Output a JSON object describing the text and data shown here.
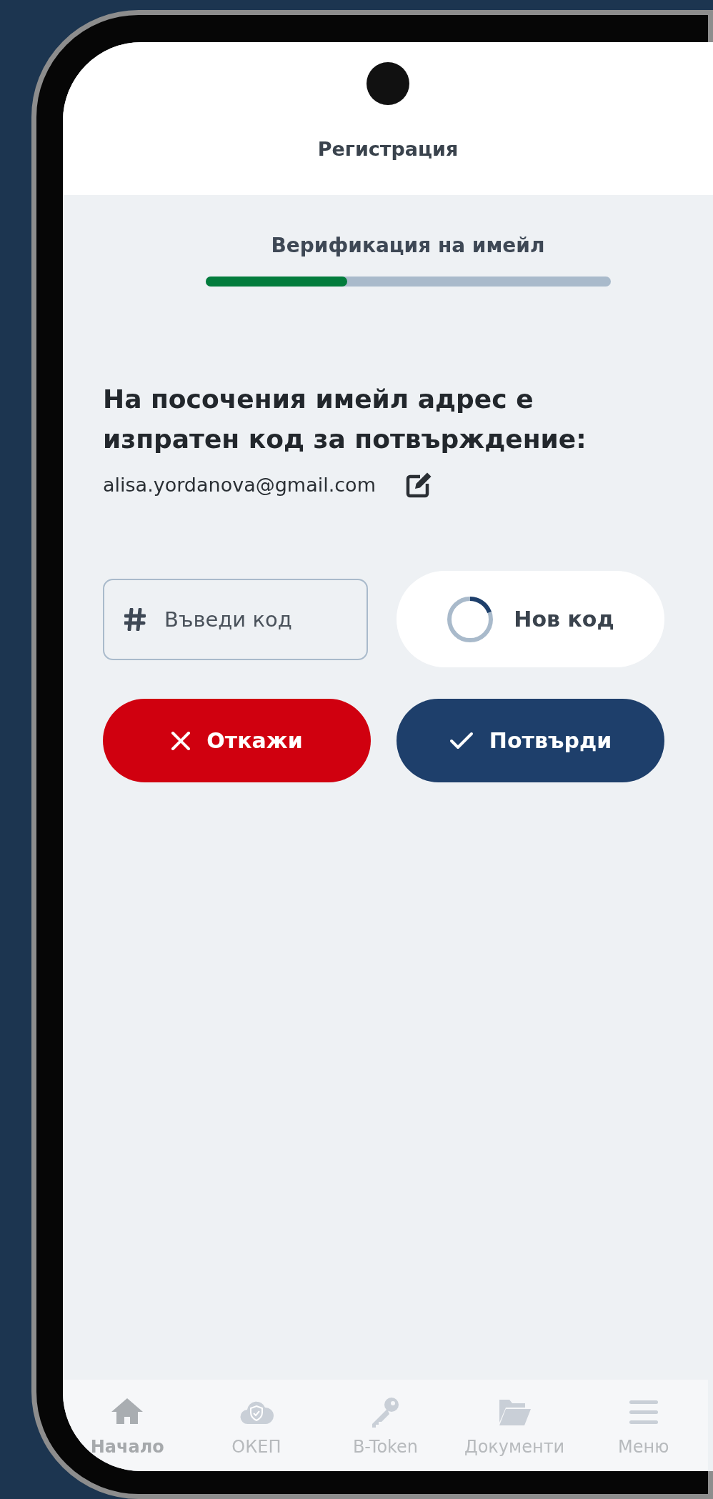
{
  "header": {
    "title": "Регистрация"
  },
  "progress": {
    "label": "Верификация на имейл",
    "level": 0.35
  },
  "message": "На посочения имейл адрес е изпратен код за потвърждение:",
  "email": "alisa.yordanova@gmail.com",
  "code_field": {
    "placeholder": "Въведи код"
  },
  "new_code_button": {
    "label": "Нов код"
  },
  "buttons": [
    {
      "kind": "cancel",
      "label": "Откажи"
    },
    {
      "kind": "confirm",
      "label": "Потвърди"
    }
  ],
  "nav": [
    {
      "kind": "home",
      "label": "Начало",
      "selected": true
    },
    {
      "kind": "cloud",
      "label": "ОКЕП",
      "selected": false
    },
    {
      "kind": "key",
      "label": "B-Token",
      "selected": false
    },
    {
      "kind": "folder",
      "label": "Документи",
      "selected": false
    },
    {
      "kind": "menu",
      "label": "Меню",
      "selected": false
    }
  ]
}
